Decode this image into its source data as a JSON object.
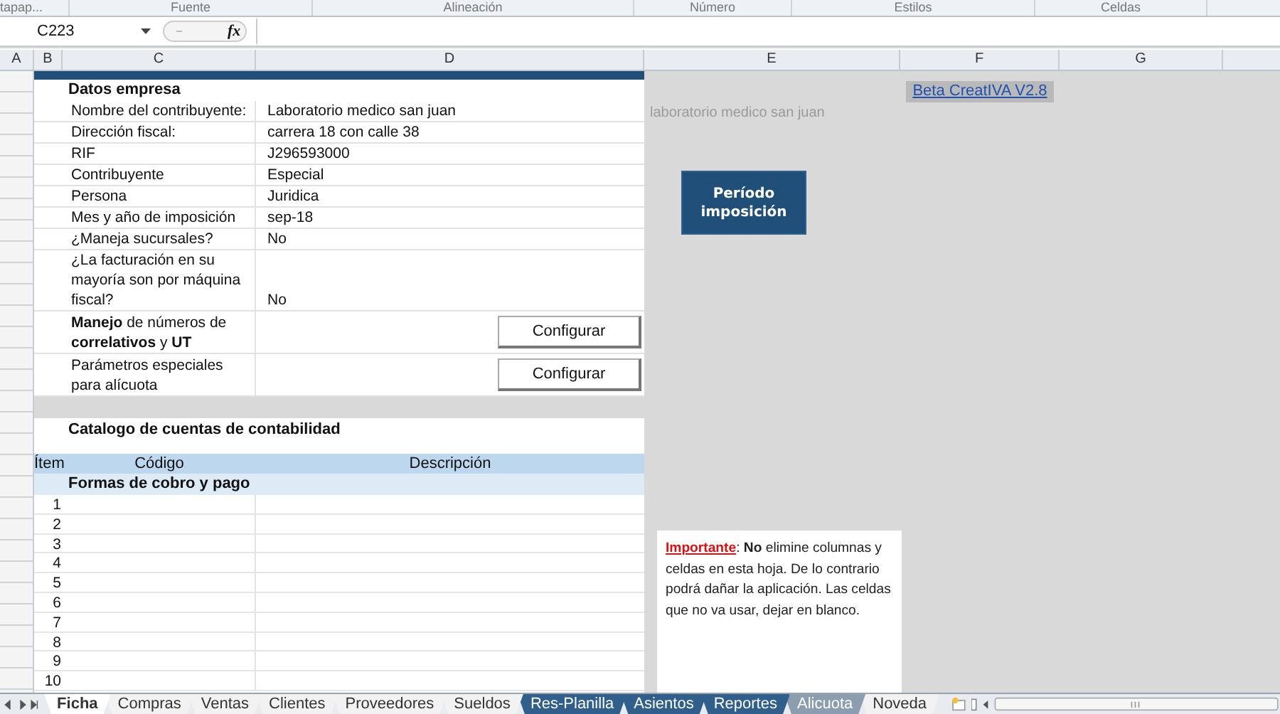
{
  "ribbon_groups": [
    "tapap...",
    "Fuente",
    "Alineación",
    "Número",
    "Estilos",
    "Celdas"
  ],
  "name_box": "C223",
  "formula_label": "fx",
  "columns": [
    "A",
    "B",
    "C",
    "D",
    "E",
    "F",
    "G"
  ],
  "company": {
    "title": "Datos empresa",
    "rows": [
      {
        "label": "Nombre del contribuyente:",
        "value": "Laboratorio medico san juan"
      },
      {
        "label": "Dirección fiscal:",
        "value": "carrera 18 con calle 38"
      },
      {
        "label": "RIF",
        "value": "J296593000"
      },
      {
        "label": "Contribuyente",
        "value": "Especial"
      },
      {
        "label": "Persona",
        "value": "Juridica"
      },
      {
        "label": "Mes y año de imposición",
        "value": "sep-18"
      },
      {
        "label": "¿Maneja sucursales?",
        "value": "No"
      },
      {
        "label": "¿La facturación en su mayoría son por máquina fiscal?",
        "value": "No"
      }
    ],
    "actions": [
      {
        "label": "**Manejo** de números de **correlativos** y **UT**",
        "button": "Configurar"
      },
      {
        "label": "Parámetros especiales para alícuota",
        "button": "Configurar"
      }
    ]
  },
  "ghost_text": "laboratorio medico san juan",
  "version_link": "Beta CreatIVA V2.8",
  "period_button": "Período imposición",
  "catalog": {
    "title": "Catalogo de cuentas de contabilidad",
    "columns": [
      "Ítem",
      "Código",
      "Descripción"
    ],
    "section": "Formas de cobro y pago",
    "rows": [
      "1",
      "2",
      "3",
      "4",
      "5",
      "6",
      "7",
      "8",
      "9",
      "10"
    ]
  },
  "note": {
    "label": "Importante",
    "text": ": **No** elimine columnas y celdas en esta hoja. De lo contrario podrá dañar la aplicación. Las celdas que no va usar, dejar en blanco."
  },
  "sheet_tabs": [
    {
      "label": "Ficha",
      "selected": true,
      "color": "#ffffff"
    },
    {
      "label": "Compras",
      "selected": false,
      "color": "#f2f2f2"
    },
    {
      "label": "Ventas",
      "selected": false,
      "color": "#f2f2f2"
    },
    {
      "label": "Clientes",
      "selected": false,
      "color": "#f2f2f2"
    },
    {
      "label": "Proveedores",
      "selected": false,
      "color": "#f2f2f2"
    },
    {
      "label": "Sueldos",
      "selected": false,
      "color": "#f2f2f2"
    },
    {
      "label": "Res-Planilla",
      "selected": false,
      "color": "#2f5f8a"
    },
    {
      "label": "Asientos",
      "selected": false,
      "color": "#2f5f8a"
    },
    {
      "label": "Reportes",
      "selected": false,
      "color": "#2f5f8a"
    },
    {
      "label": "Alicuota",
      "selected": false,
      "color": "#8c9db0"
    },
    {
      "label": "Noveda",
      "selected": false,
      "color": "#f2f2f2"
    }
  ]
}
